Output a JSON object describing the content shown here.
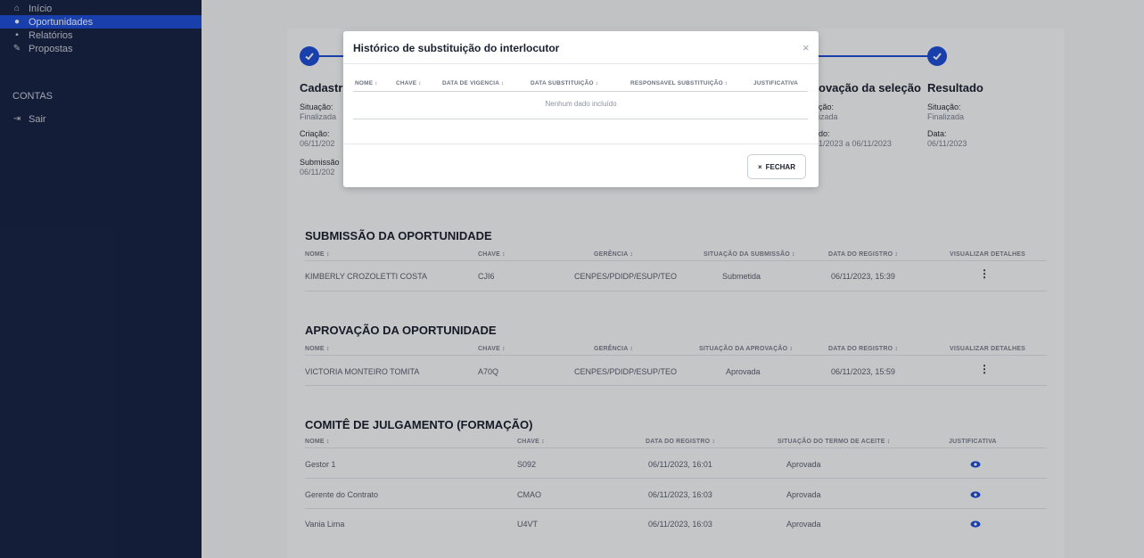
{
  "sidebar": {
    "items": [
      {
        "label": "Início",
        "icon": "home-icon"
      },
      {
        "label": "Oportunidades",
        "icon": "lightbulb-icon"
      },
      {
        "label": "Relatórios",
        "icon": "document-icon"
      },
      {
        "label": "Propostas",
        "icon": "edit-doc-icon"
      }
    ],
    "section": "CONTAS",
    "logout": "Sair"
  },
  "stepper": {
    "steps": [
      {
        "title": "Cadastr",
        "lines": [
          {
            "label": "Situação:",
            "value": "Finalizada"
          },
          {
            "label": "Criação:",
            "value": "06/11/202"
          },
          {
            "label": "Submissão",
            "value": "06/11/202"
          }
        ]
      },
      {
        "title": "ovação da seleção",
        "lines": [
          {
            "label": "ção:",
            "value": "izada"
          },
          {
            "label": "do:",
            "value": "1/2023 a 06/11/2023"
          }
        ]
      },
      {
        "title": "Resultado",
        "lines": [
          {
            "label": "Situação:",
            "value": "Finalizada"
          },
          {
            "label": "Data:",
            "value": "06/11/2023"
          }
        ]
      }
    ]
  },
  "submissao": {
    "title": "SUBMISSÃO DA OPORTUNIDADE",
    "headers": [
      "NOME ↕",
      "CHAVE ↕",
      "GERÊNCIA ↕",
      "SITUAÇÃO DA SUBMISSÃO ↕",
      "DATA DO REGISTRO ↕",
      "VISUALIZAR DETALHES"
    ],
    "row": [
      "KIMBERLY CROZOLETTI COSTA",
      "CJI6",
      "CENPES/PDIDP/ESUP/TEO",
      "Submetida",
      "06/11/2023, 15:39"
    ]
  },
  "aprovacao": {
    "title": "APROVAÇÃO DA OPORTUNIDADE",
    "headers": [
      "NOME ↕",
      "CHAVE ↕",
      "GERÊNCIA ↕",
      "SITUAÇÃO DA APROVAÇÃO ↕",
      "DATA DO REGISTRO ↕",
      "VISUALIZAR DETALHES"
    ],
    "row": [
      "VICTORIA MONTEIRO TOMITA",
      "A70Q",
      "CENPES/PDIDP/ESUP/TEO",
      "Aprovada",
      "06/11/2023, 15:59"
    ]
  },
  "comite": {
    "title": "COMITÊ DE JULGAMENTO (FORMAÇÃO)",
    "headers": [
      "NOME ↕",
      "CHAVE ↕",
      "DATA DO REGISTRO ↕",
      "SITUAÇÃO DO TERMO DE ACEITE ↕",
      "JUSTIFICATIVA"
    ],
    "rows": [
      [
        "Gestor 1",
        "S092",
        "06/11/2023, 16:01",
        "Aprovada"
      ],
      [
        "Gerente do Contrato",
        "CMAO",
        "06/11/2023, 16:03",
        "Aprovada"
      ],
      [
        "Vania Lima",
        "U4VT",
        "06/11/2023, 16:03",
        "Aprovada"
      ]
    ]
  },
  "modal": {
    "title": "Histórico de substituição do interlocutor",
    "close": "×",
    "headers": [
      "NOME ↕",
      "CHAVE ↕",
      "DATA DE VIGENCIA ↕",
      "DATA SUBSTITUIÇÃO ↕",
      "RESPONSAVEL SUBSTITUIÇÃO ↕",
      "JUSTIFICATIVA"
    ],
    "empty": "Nenhum dado incluído",
    "button": "FECHAR",
    "button_icon": "×"
  },
  "colors": {
    "primary": "#1f4fd6",
    "sidebar": "#1a2547"
  }
}
